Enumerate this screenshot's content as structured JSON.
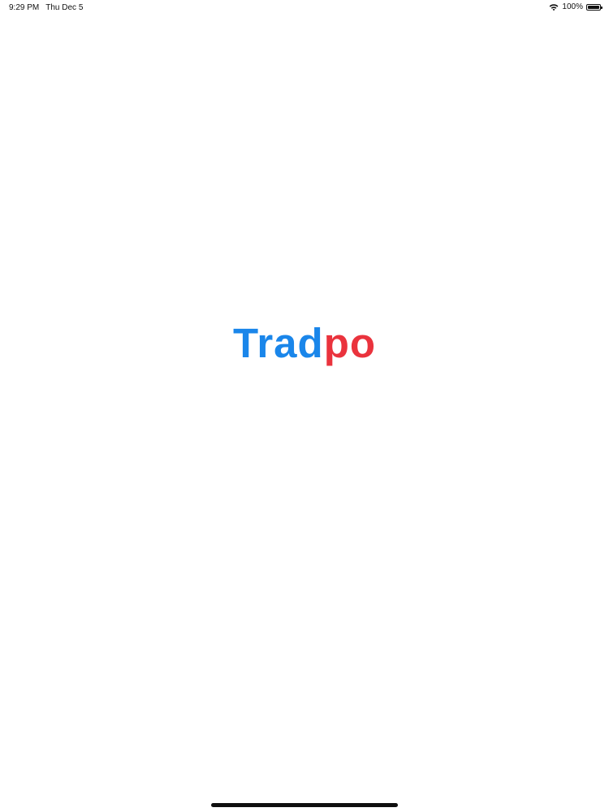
{
  "status_bar": {
    "time": "9:29 PM",
    "date": "Thu Dec 5",
    "battery_text": "100%",
    "battery_level": 1.0
  },
  "logo": {
    "part_blue": "Trad",
    "part_red": "po",
    "colors": {
      "blue": "#1a86ea",
      "red": "#ea333d"
    }
  },
  "icons": [
    "wifi-icon",
    "battery-icon"
  ]
}
